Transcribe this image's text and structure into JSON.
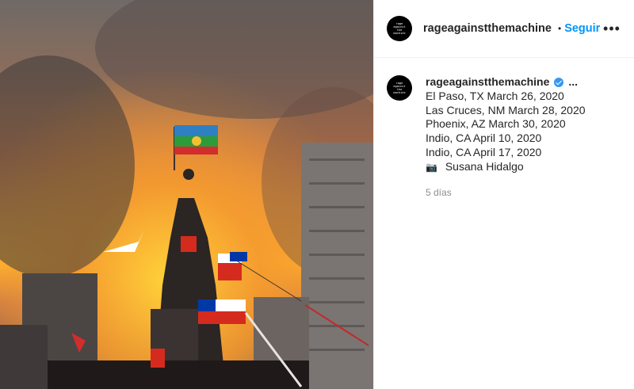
{
  "post": {
    "image": {
      "description_icon": "protest-photo",
      "flag_colors": {
        "mapuche_blue": "#2f7fc3",
        "mapuche_green": "#2e9b3a",
        "mapuche_red": "#d22d2d",
        "chile_red": "#d52b1e",
        "chile_blue": "#0039a6"
      }
    },
    "header": {
      "avatar_text": "rage against the machine",
      "username": "rageagainstthemachine",
      "separator": "•",
      "follow_label": "Seguir",
      "more_icon": "more-icon"
    },
    "caption": {
      "username": "rageagainstthemachine",
      "verified_icon": "verified-badge-icon",
      "truncation": "...",
      "lines": [
        "El Paso, TX March 26, 2020",
        "Las Cruces, NM March 28, 2020",
        "Phoenix, AZ March 30, 2020",
        "Indio, CA April 10, 2020",
        "Indio, CA April 17, 2020"
      ],
      "credit_icon": "📷",
      "credit": "Susana Hidalgo",
      "timestamp": "5 días"
    }
  }
}
